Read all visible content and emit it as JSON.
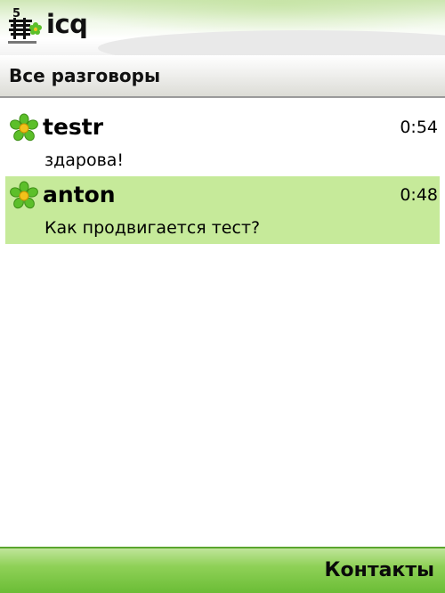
{
  "header": {
    "app_title": "icq",
    "status_icon": "connection-status-icon"
  },
  "section": {
    "title": "Все разговоры"
  },
  "conversations": [
    {
      "name": "testr",
      "time": "0:54",
      "message": "здарова!",
      "icon": "icq-flower-icon",
      "selected": false
    },
    {
      "name": "anton",
      "time": "0:48",
      "message": "Как продвигается тест?",
      "icon": "icq-flower-icon",
      "selected": true
    }
  ],
  "softkeys": {
    "right_label": "Контакты"
  },
  "colors": {
    "accent_green": "#8fd157",
    "selection": "#c6ea9a",
    "flower_petals": "#5cbf2a",
    "flower_center": "#f2c21b"
  }
}
